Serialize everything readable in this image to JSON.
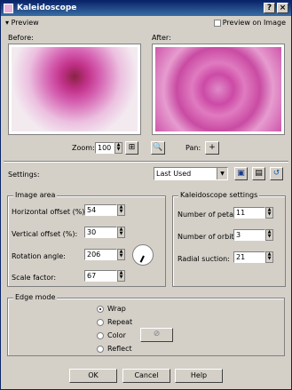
{
  "window": {
    "title": "Kaleidoscope",
    "close": "×",
    "help": "?"
  },
  "preview": {
    "toggle_label": "Preview",
    "on_image_label": "Preview on Image",
    "before_label": "Before:",
    "after_label": "After:"
  },
  "zoom": {
    "label": "Zoom:",
    "value": "100"
  },
  "pan": {
    "label": "Pan:",
    "icon": "+"
  },
  "settings": {
    "label": "Settings:",
    "selected": "Last Used",
    "dropdown_arrow": "▼"
  },
  "image_area": {
    "title": "Image area",
    "horizontal_offset": {
      "label": "Horizontal offset (%):",
      "value": "54"
    },
    "vertical_offset": {
      "label": "Vertical offset (%):",
      "value": "30"
    },
    "rotation_angle": {
      "label": "Rotation angle:",
      "value": "206"
    },
    "scale_factor": {
      "label": "Scale factor:",
      "value": "67"
    }
  },
  "kaleidoscope": {
    "title": "Kaleidoscope settings",
    "petals": {
      "label": "Number of petals:",
      "value": "11"
    },
    "orbits": {
      "label": "Number of orbits:",
      "value": "3"
    },
    "suction": {
      "label": "Radial suction:",
      "value": "21"
    }
  },
  "edge_mode": {
    "title": "Edge mode",
    "options": [
      "Wrap",
      "Repeat",
      "Color",
      "Reflect"
    ],
    "selected": "Wrap",
    "no_color_icon": "⊘"
  },
  "buttons": {
    "ok": "OK",
    "cancel": "Cancel",
    "help": "Help"
  }
}
